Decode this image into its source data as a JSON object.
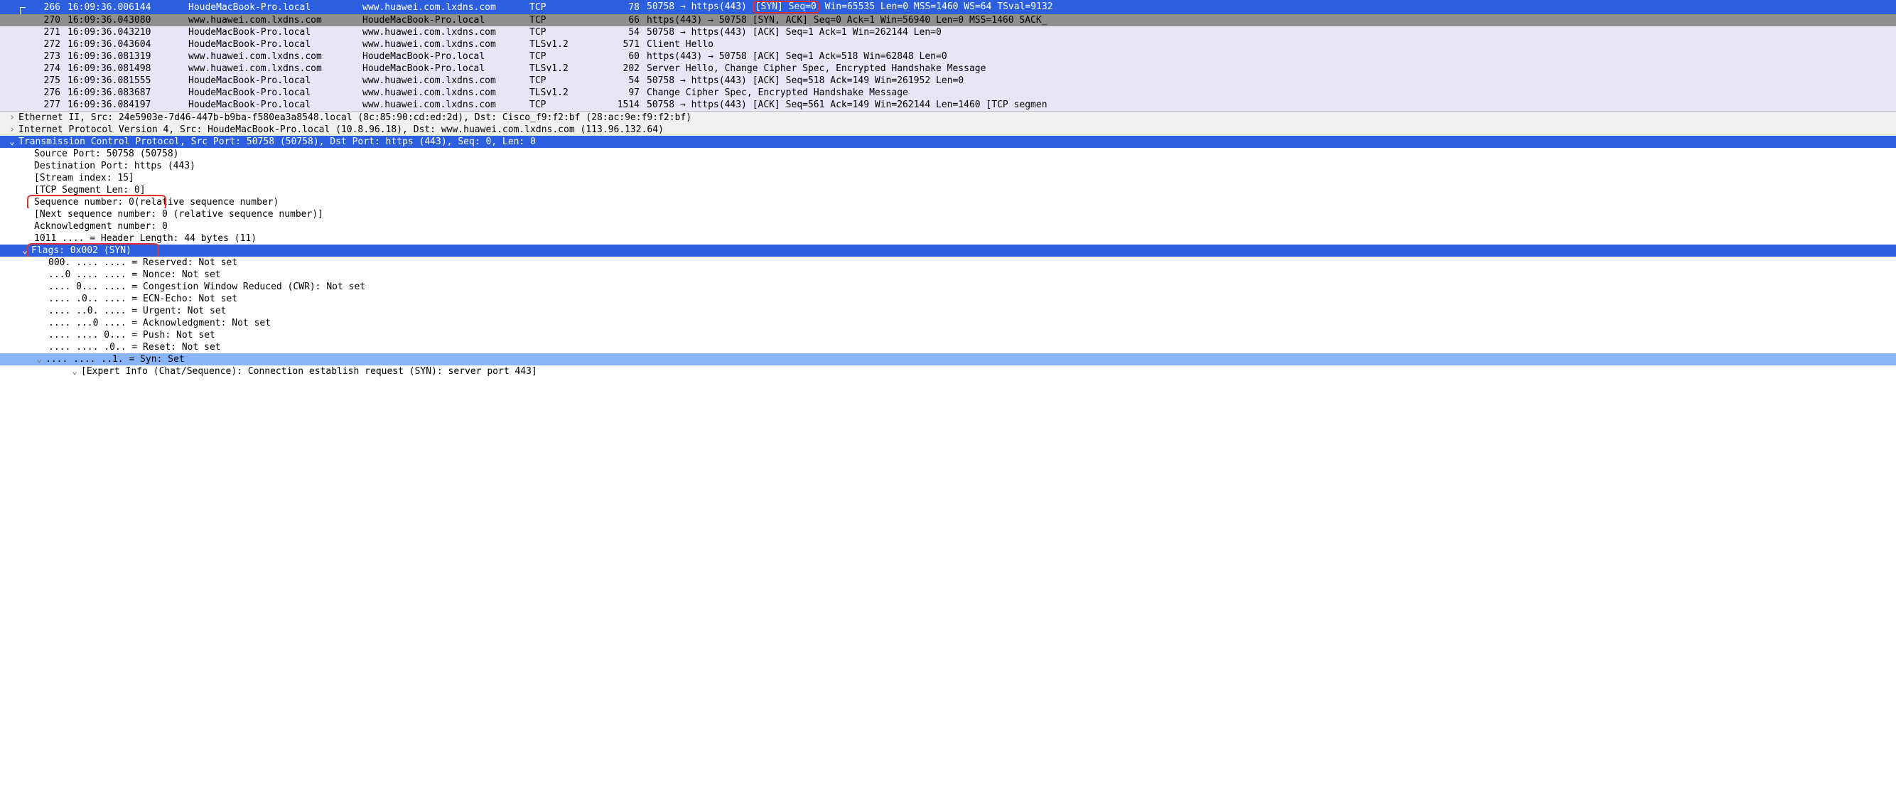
{
  "packets": [
    {
      "no": "266",
      "time": "16:09:36.006144",
      "src": "HoudeMacBook-Pro.local",
      "dst": "www.huawei.com.lxdns.com",
      "proto": "TCP",
      "len": "78",
      "info_pre": "50758 → https(443) ",
      "info_ann": "[SYN] Seq=0",
      "info_post": " Win=65535 Len=0 MSS=1460 WS=64 TSval=9132",
      "cls": "selected",
      "bracket": true,
      "annot": true
    },
    {
      "no": "270",
      "time": "16:09:36.043080",
      "src": "www.huawei.com.lxdns.com",
      "dst": "HoudeMacBook-Pro.local",
      "proto": "TCP",
      "len": "66",
      "info": "https(443) → 50758 [SYN, ACK] Seq=0 Ack=1 Win=56940 Len=0 MSS=1460 SACK_",
      "cls": "ack"
    },
    {
      "no": "271",
      "time": "16:09:36.043210",
      "src": "HoudeMacBook-Pro.local",
      "dst": "www.huawei.com.lxdns.com",
      "proto": "TCP",
      "len": "54",
      "info": "50758 → https(443) [ACK] Seq=1 Ack=1 Win=262144 Len=0",
      "cls": "normal"
    },
    {
      "no": "272",
      "time": "16:09:36.043604",
      "src": "HoudeMacBook-Pro.local",
      "dst": "www.huawei.com.lxdns.com",
      "proto": "TLSv1.2",
      "len": "571",
      "info": "Client Hello",
      "cls": "normal"
    },
    {
      "no": "273",
      "time": "16:09:36.081319",
      "src": "www.huawei.com.lxdns.com",
      "dst": "HoudeMacBook-Pro.local",
      "proto": "TCP",
      "len": "60",
      "info": "https(443) → 50758 [ACK] Seq=1 Ack=518 Win=62848 Len=0",
      "cls": "normal"
    },
    {
      "no": "274",
      "time": "16:09:36.081498",
      "src": "www.huawei.com.lxdns.com",
      "dst": "HoudeMacBook-Pro.local",
      "proto": "TLSv1.2",
      "len": "202",
      "info": "Server Hello, Change Cipher Spec, Encrypted Handshake Message",
      "cls": "normal"
    },
    {
      "no": "275",
      "time": "16:09:36.081555",
      "src": "HoudeMacBook-Pro.local",
      "dst": "www.huawei.com.lxdns.com",
      "proto": "TCP",
      "len": "54",
      "info": "50758 → https(443) [ACK] Seq=518 Ack=149 Win=261952 Len=0",
      "cls": "normal"
    },
    {
      "no": "276",
      "time": "16:09:36.083687",
      "src": "HoudeMacBook-Pro.local",
      "dst": "www.huawei.com.lxdns.com",
      "proto": "TLSv1.2",
      "len": "97",
      "info": "Change Cipher Spec, Encrypted Handshake Message",
      "cls": "normal"
    },
    {
      "no": "277",
      "time": "16:09:36.084197",
      "src": "HoudeMacBook-Pro.local",
      "dst": "www.huawei.com.lxdns.com",
      "proto": "TCP",
      "len": "1514",
      "info": "50758 → https(443) [ACK] Seq=561 Ack=149 Win=262144 Len=1460 [TCP segmen",
      "cls": "normal"
    }
  ],
  "detail": {
    "eth": "Ethernet II, Src: 24e5903e-7d46-447b-b9ba-f580ea3a8548.local (8c:85:90:cd:ed:2d), Dst: Cisco_f9:f2:bf (28:ac:9e:f9:f2:bf)",
    "ip": "Internet Protocol Version 4, Src: HoudeMacBook-Pro.local (10.8.96.18), Dst: www.huawei.com.lxdns.com (113.96.132.64)",
    "tcp_header": "Transmission Control Protocol, Src Port: 50758 (50758), Dst Port: https (443), Seq: 0, Len: 0",
    "srcport": "Source Port: 50758 (50758)",
    "dstport": "Destination Port: https (443)",
    "stream": "[Stream index: 15]",
    "seglen": "[TCP Segment Len: 0]",
    "seqnum": "Sequence number: 0",
    "seqnum_suffix": "    (relative sequence number)",
    "nextseq": "[Next sequence number: 0    (relative sequence number)]",
    "acknum": "Acknowledgment number: 0",
    "hdrlen": "1011 .... = Header Length: 44 bytes (11)",
    "flags_header": "Flags: 0x002 (SYN)",
    "flags": [
      "000. .... .... = Reserved: Not set",
      "...0 .... .... = Nonce: Not set",
      ".... 0... .... = Congestion Window Reduced (CWR): Not set",
      ".... .0.. .... = ECN-Echo: Not set",
      ".... ..0. .... = Urgent: Not set",
      ".... ...0 .... = Acknowledgment: Not set",
      ".... .... 0... = Push: Not set",
      ".... .... .0.. = Reset: Not set"
    ],
    "syn_set": ".... .... ..1. = Syn: Set",
    "expert": "[Expert Info (Chat/Sequence): Connection establish request (SYN): server port 443]"
  },
  "glyph": {
    "right": "›",
    "down": "⌄"
  }
}
